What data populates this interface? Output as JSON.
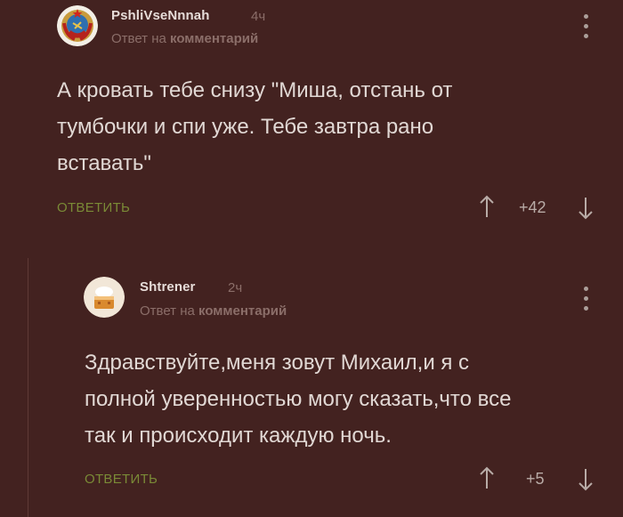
{
  "comments": [
    {
      "username": "PshliVseNnnah",
      "time": "4ч",
      "reply_prefix": "Ответ на",
      "reply_target": "комментарий",
      "text_lines": [
        "А кровать тебе снизу \"Миша, отстань от",
        "тумбочки и спи уже. Тебе завтра рано",
        "вставать\""
      ],
      "reply_label": "ОТВЕТИТЬ",
      "score": "+42"
    },
    {
      "username": "Shtrener",
      "time": "2ч",
      "reply_prefix": "Ответ на",
      "reply_target": "комментарий",
      "text_lines": [
        "Здравствуйте,меня зовут Михаил,и я с",
        "полной уверенностью могу сказать,что все",
        "так и происходит каждую ночь."
      ],
      "reply_label": "ОТВЕТИТЬ",
      "score": "+5"
    }
  ],
  "colors": {
    "background": "#432220",
    "reply_accent": "#7a8a36",
    "muted": "#8b6e69",
    "thread_line": "#5f3a36"
  },
  "icons": [
    "ussr-emblem-avatar",
    "cake-avatar",
    "arrow-up-icon",
    "arrow-down-icon",
    "more-vertical-icon"
  ]
}
